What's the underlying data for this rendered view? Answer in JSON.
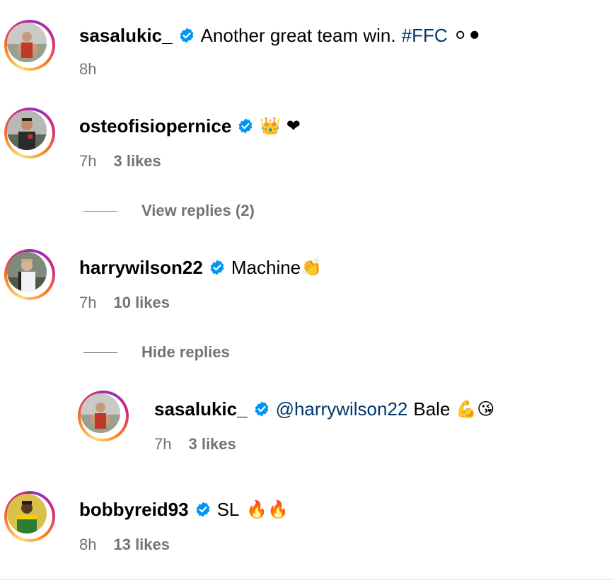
{
  "comments": [
    {
      "username": "sasalukic_",
      "text": "Another great team win.",
      "hashtag": "#FFC",
      "emoji": "⚪⚫",
      "time": "8h",
      "likes": ""
    },
    {
      "username": "osteofisiopernice",
      "text": "",
      "emoji": "👑 ❤",
      "time": "7h",
      "likes": "3 likes",
      "replies_toggle": "View replies (2)"
    },
    {
      "username": "harrywilson22",
      "text": "Machine",
      "emoji": "👏",
      "time": "7h",
      "likes": "10 likes",
      "replies_toggle": "Hide replies",
      "reply": {
        "username": "sasalukic_",
        "mention": "@harrywilson22",
        "text": "Bale",
        "emoji": "💪😘",
        "time": "7h",
        "likes": "3 likes"
      }
    },
    {
      "username": "bobbyreid93",
      "text": "SL",
      "emoji": "🔥🔥",
      "time": "8h",
      "likes": "13 likes"
    }
  ],
  "colors": {
    "link": "#00376b",
    "meta": "#737373",
    "verified": "#0095f6"
  },
  "icons": {
    "verified": "verified-badge-icon"
  }
}
